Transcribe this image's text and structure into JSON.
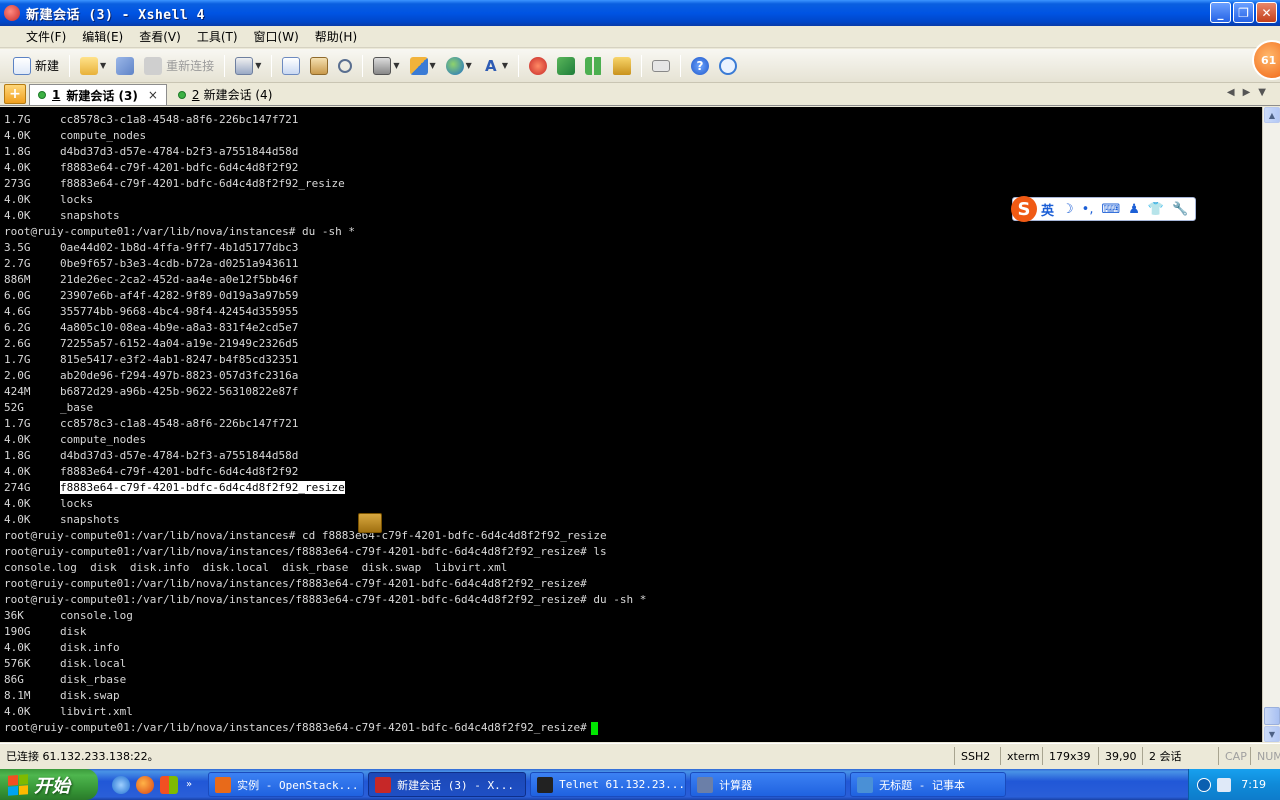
{
  "window": {
    "title": "新建会话 (3) - Xshell 4"
  },
  "menu": [
    "文件(F)",
    "编辑(E)",
    "查看(V)",
    "工具(T)",
    "窗口(W)",
    "帮助(H)"
  ],
  "toolbar": {
    "new_label": "新建",
    "reconnect_label": "重新连接",
    "badge": "61"
  },
  "tabs": [
    {
      "number": "1",
      "label": "新建会话 (3)",
      "close": "×"
    },
    {
      "number": "2",
      "label": "新建会话 (4)"
    }
  ],
  "terminal": {
    "lines": [
      {
        "size": "1.7G",
        "name": "cc8578c3-c1a8-4548-a8f6-226bc147f721"
      },
      {
        "size": "4.0K",
        "name": "compute_nodes"
      },
      {
        "size": "1.8G",
        "name": "d4bd37d3-d57e-4784-b2f3-a7551844d58d"
      },
      {
        "size": "4.0K",
        "name": "f8883e64-c79f-4201-bdfc-6d4c4d8f2f92"
      },
      {
        "size": "273G",
        "name": "f8883e64-c79f-4201-bdfc-6d4c4d8f2f92_resize"
      },
      {
        "size": "4.0K",
        "name": "locks"
      },
      {
        "size": "4.0K",
        "name": "snapshots"
      },
      {
        "text": "root@ruiy-compute01:/var/lib/nova/instances# du -sh *"
      },
      {
        "size": "3.5G",
        "name": "0ae44d02-1b8d-4ffa-9ff7-4b1d5177dbc3"
      },
      {
        "size": "2.7G",
        "name": "0be9f657-b3e3-4cdb-b72a-d0251a943611"
      },
      {
        "size": "886M",
        "name": "21de26ec-2ca2-452d-aa4e-a0e12f5bb46f"
      },
      {
        "size": "6.0G",
        "name": "23907e6b-af4f-4282-9f89-0d19a3a97b59"
      },
      {
        "size": "4.6G",
        "name": "355774bb-9668-4bc4-98f4-42454d355955"
      },
      {
        "size": "6.2G",
        "name": "4a805c10-08ea-4b9e-a8a3-831f4e2cd5e7"
      },
      {
        "size": "2.6G",
        "name": "72255a57-6152-4a04-a19e-21949c2326d5"
      },
      {
        "size": "1.7G",
        "name": "815e5417-e3f2-4ab1-8247-b4f85cd32351"
      },
      {
        "size": "2.0G",
        "name": "ab20de96-f294-497b-8823-057d3fc2316a"
      },
      {
        "size": "424M",
        "name": "b6872d29-a96b-425b-9622-56310822e87f"
      },
      {
        "size": "52G",
        "name": "_base"
      },
      {
        "size": "1.7G",
        "name": "cc8578c3-c1a8-4548-a8f6-226bc147f721"
      },
      {
        "size": "4.0K",
        "name": "compute_nodes"
      },
      {
        "size": "1.8G",
        "name": "d4bd37d3-d57e-4784-b2f3-a7551844d58d"
      },
      {
        "size": "4.0K",
        "name": "f8883e64-c79f-4201-bdfc-6d4c4d8f2f92"
      },
      {
        "size": "274G",
        "name": "f8883e64-c79f-4201-bdfc-6d4c4d8f2f92_resize",
        "highlight": true
      },
      {
        "size": "4.0K",
        "name": "locks"
      },
      {
        "size": "4.0K",
        "name": "snapshots"
      },
      {
        "text": "root@ruiy-compute01:/var/lib/nova/instances# cd f8883e64-c79f-4201-bdfc-6d4c4d8f2f92_resize"
      },
      {
        "text": "root@ruiy-compute01:/var/lib/nova/instances/f8883e64-c79f-4201-bdfc-6d4c4d8f2f92_resize# ls"
      },
      {
        "text": "console.log  disk  disk.info  disk.local  disk_rbase  disk.swap  libvirt.xml"
      },
      {
        "text": "root@ruiy-compute01:/var/lib/nova/instances/f8883e64-c79f-4201-bdfc-6d4c4d8f2f92_resize#"
      },
      {
        "text": "root@ruiy-compute01:/var/lib/nova/instances/f8883e64-c79f-4201-bdfc-6d4c4d8f2f92_resize# du -sh *"
      },
      {
        "size": "36K",
        "name": "console.log"
      },
      {
        "size": "190G",
        "name": "disk"
      },
      {
        "size": "4.0K",
        "name": "disk.info"
      },
      {
        "size": "576K",
        "name": "disk.local"
      },
      {
        "size": "86G",
        "name": "disk_rbase"
      },
      {
        "size": "8.1M",
        "name": "disk.swap"
      },
      {
        "size": "4.0K",
        "name": "libvirt.xml"
      },
      {
        "text": "root@ruiy-compute01:/var/lib/nova/instances/f8883e64-c79f-4201-bdfc-6d4c4d8f2f92_resize#",
        "cursor": true
      }
    ]
  },
  "ime": {
    "mode": "英"
  },
  "status": {
    "connection": "已连接 61.132.233.138:22。",
    "protocol": "SSH2",
    "term": "xterm",
    "dimensions": "179x39",
    "cursor_pos": "39,90",
    "sessions": "2 会话",
    "cap": "CAP",
    "num": "NUM"
  },
  "taskbar": {
    "start_label": "开始",
    "quicklaunch_more": "»",
    "tasks": [
      {
        "label": "实例 - OpenStack...",
        "icon_color": "#e86a1a"
      },
      {
        "label": "新建会话 (3) - X...",
        "icon_color": "#c62828",
        "active": true
      },
      {
        "label": "Telnet 61.132.23...",
        "icon_color": "#222222"
      },
      {
        "label": "计算器",
        "icon_color": "#6b7fa8"
      },
      {
        "label": "无标题 - 记事本",
        "icon_color": "#4a90d6"
      }
    ],
    "clock": "7:19"
  }
}
